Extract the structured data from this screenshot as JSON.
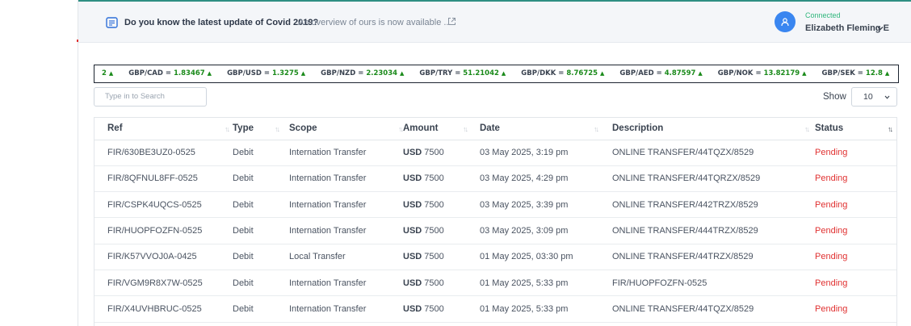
{
  "header": {
    "news_bold": "Do you know the latest update of Covid 2019?",
    "news_rest": "An overview of ours is now available ...",
    "news_icon": "news-icon",
    "external_icon": "external-link-icon",
    "user": {
      "status": "Connected",
      "name": "Elizabeth Fleming E",
      "avatar_icon": "user-icon",
      "caret_icon": "chevron-down-icon"
    }
  },
  "ticker": {
    "items": [
      {
        "pair": "",
        "value": "2"
      },
      {
        "pair": "GBP/CAD = ",
        "value": "1.83467"
      },
      {
        "pair": "GBP/USD = ",
        "value": "1.3275"
      },
      {
        "pair": "GBP/NZD = ",
        "value": "2.23034"
      },
      {
        "pair": "GBP/TRY = ",
        "value": "51.21042"
      },
      {
        "pair": "GBP/DKK = ",
        "value": "8.76725"
      },
      {
        "pair": "GBP/AED = ",
        "value": "4.87597"
      },
      {
        "pair": "GBP/NOK = ",
        "value": "13.82179"
      },
      {
        "pair": "GBP/SEK = ",
        "value": "12.8"
      }
    ],
    "up_glyph": "▲"
  },
  "search": {
    "placeholder": "Type in to Search"
  },
  "show": {
    "label": "Show",
    "value": "10"
  },
  "table": {
    "columns": [
      "Ref",
      "Type",
      "Scope",
      "Amount",
      "Date",
      "Description",
      "Status"
    ],
    "rows": [
      {
        "ref": "FIR/630BE3UZ0-0525",
        "type": "Debit",
        "scope": "Internation Transfer",
        "currency": "USD",
        "amount": "7500",
        "date": "03 May 2025, 3:19 pm",
        "description": "ONLINE TRANSFER/44TQZX/8529",
        "status": "Pending"
      },
      {
        "ref": "FIR/8QFNUL8FF-0525",
        "type": "Debit",
        "scope": "Internation Transfer",
        "currency": "USD",
        "amount": "7500",
        "date": "03 May 2025, 4:29 pm",
        "description": "ONLINE TRANSFER/44TQRZX/8529",
        "status": "Pending"
      },
      {
        "ref": "FIR/CSPK4UQCS-0525",
        "type": "Debit",
        "scope": "Internation Transfer",
        "currency": "USD",
        "amount": "7500",
        "date": "03 May 2025, 3:39 pm",
        "description": "ONLINE TRANSFER/442TRZX/8529",
        "status": "Pending"
      },
      {
        "ref": "FIR/HUOPFOZFN-0525",
        "type": "Debit",
        "scope": "Internation Transfer",
        "currency": "USD",
        "amount": "7500",
        "date": "03 May 2025, 3:09 pm",
        "description": "ONLINE TRANSFER/444TRZX/8529",
        "status": "Pending"
      },
      {
        "ref": "FIR/K57VVOJ0A-0425",
        "type": "Debit",
        "scope": "Local Transfer",
        "currency": "USD",
        "amount": "7500",
        "date": "01 May 2025, 03:30 pm",
        "description": "ONLINE TRANSFER/44TRZX/8529",
        "status": "Pending"
      },
      {
        "ref": "FIR/VGM9R8X7W-0525",
        "type": "Debit",
        "scope": "Internation Transfer",
        "currency": "USD",
        "amount": "7500",
        "date": "01 May 2025, 5:33 pm",
        "description": "FIR/HUOPFOZFN-0525",
        "status": "Pending"
      },
      {
        "ref": "FIR/X4UVHBRUC-0525",
        "type": "Debit",
        "scope": "Internation Transfer",
        "currency": "USD",
        "amount": "7500",
        "date": "01 May 2025, 5:33 pm",
        "description": "ONLINE TRANSFER/44TQZX/8529",
        "status": "Pending"
      }
    ]
  },
  "colors": {
    "accent": "#3a86f0",
    "connected": "#2fb67c",
    "pending": "#e03131",
    "ticker_up": "#1a8a1a"
  }
}
